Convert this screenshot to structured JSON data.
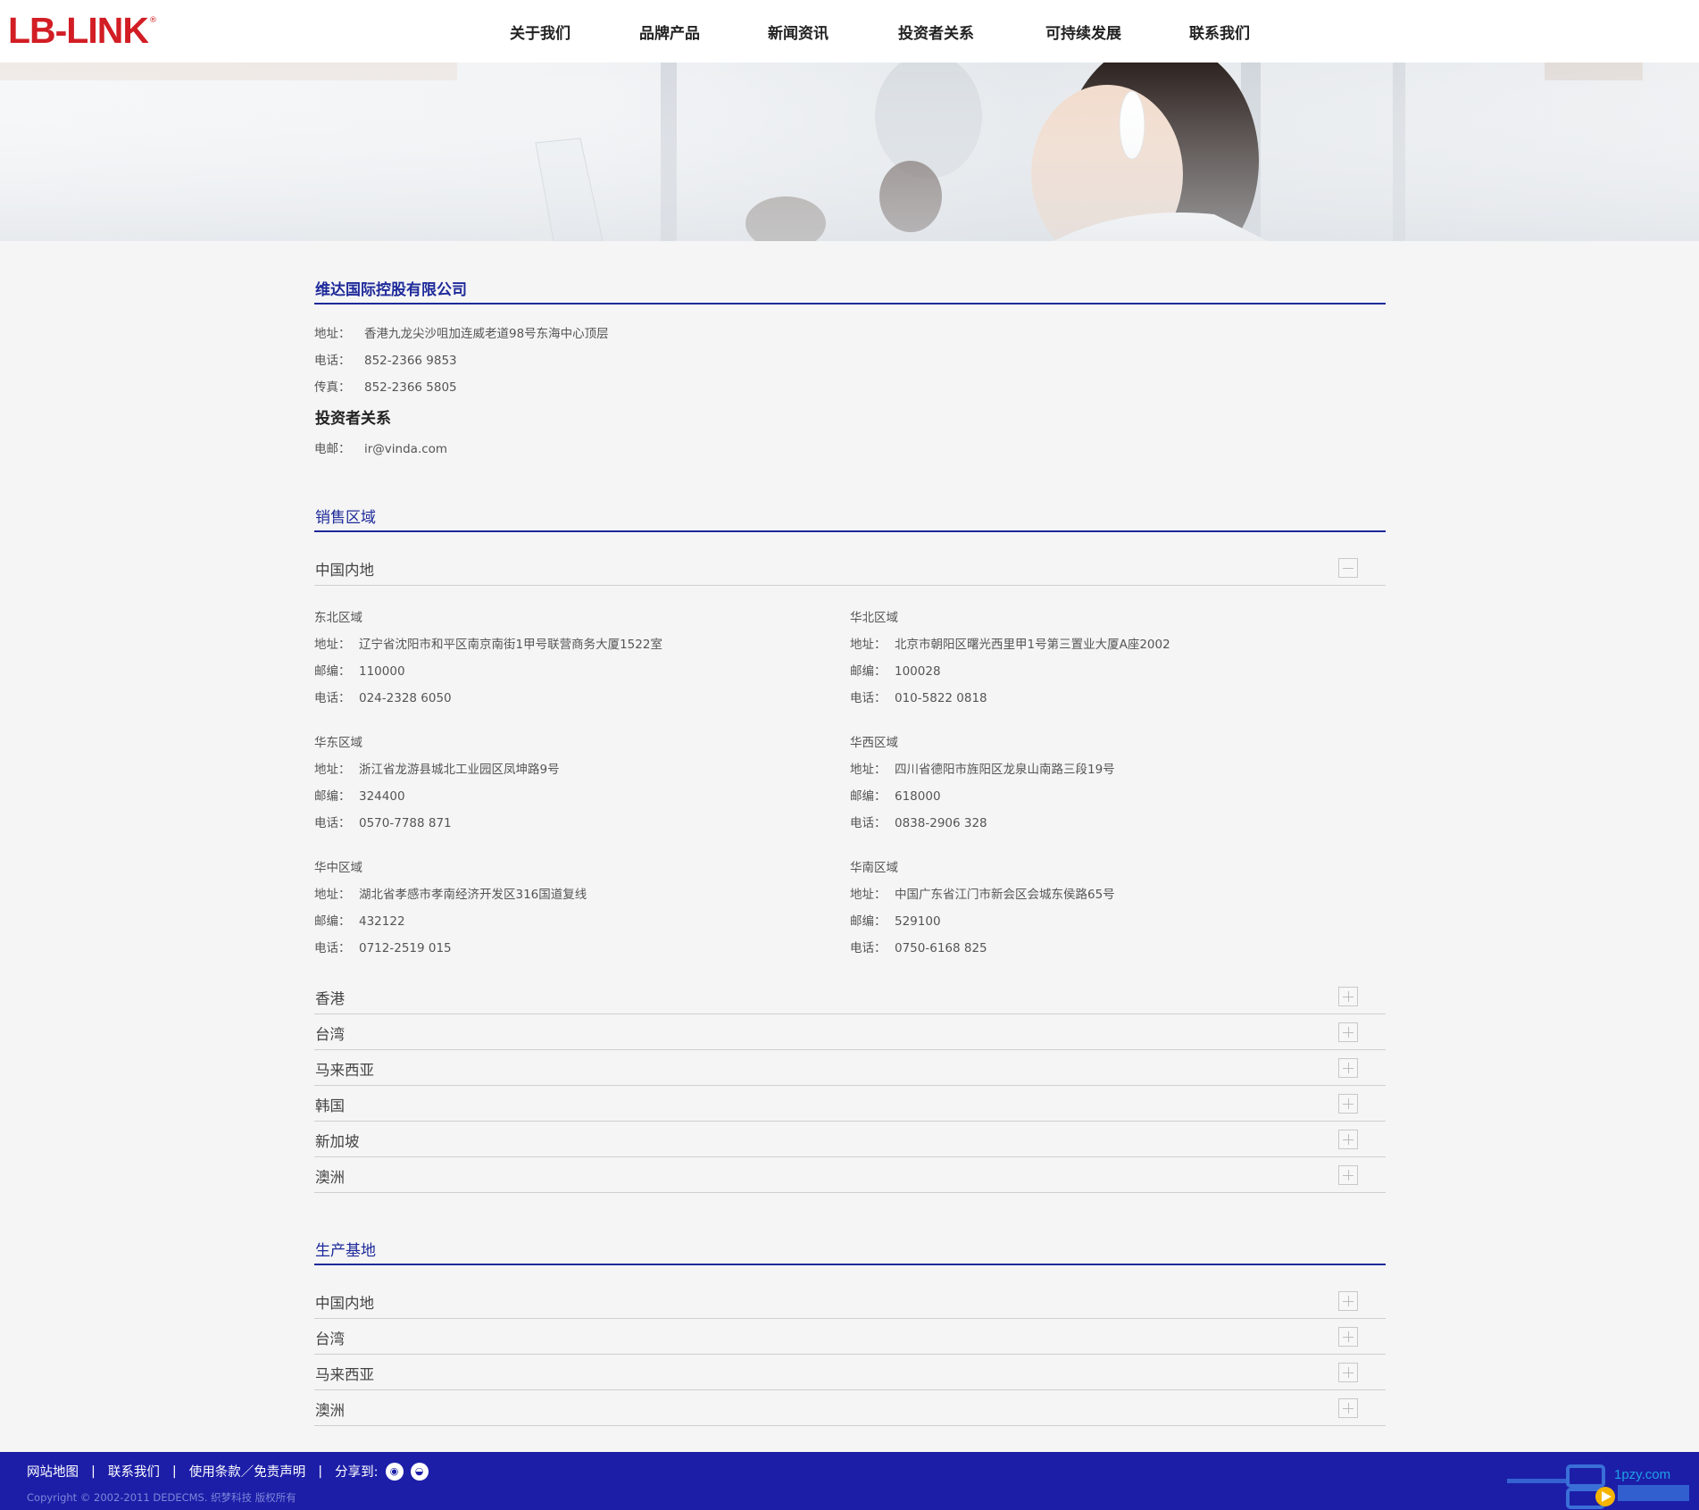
{
  "header": {
    "logo_text": "LB-LINK",
    "logo_mark": "®",
    "nav": [
      "关于我们",
      "品牌产品",
      "新闻资讯",
      "投资者关系",
      "可持续发展",
      "联系我们"
    ]
  },
  "company": {
    "name": "维达国际控股有限公司",
    "rows": [
      {
        "label": "地址：",
        "value": "香港九龙尖沙咀加连威老道98号东海中心顶层"
      },
      {
        "label": "电话：",
        "value": "852-2366 9853"
      },
      {
        "label": "传真：",
        "value": "852-2366 5805"
      }
    ],
    "ir_title": "投资者关系",
    "ir_row": {
      "label": "电邮：",
      "value": "ir@vinda.com"
    }
  },
  "sales": {
    "title": "销售区域",
    "expanded": {
      "label": "中国内地",
      "regions": [
        {
          "name": "东北区域",
          "address_label": "地址：",
          "address": "辽宁省沈阳市和平区南京南街1甲号联营商务大厦1522室",
          "zip_label": "邮编：",
          "zip": "110000",
          "phone_label": "电话：",
          "phone": "024-2328 6050"
        },
        {
          "name": "华北区域",
          "address_label": "地址：",
          "address": "北京市朝阳区曙光西里甲1号第三置业大厦A座2002",
          "zip_label": "邮编：",
          "zip": "100028",
          "phone_label": "电话：",
          "phone": "010-5822 0818"
        },
        {
          "name": "华东区域",
          "address_label": "地址：",
          "address": "浙江省龙游县城北工业园区凤坤路9号",
          "zip_label": "邮编：",
          "zip": "324400",
          "phone_label": "电话：",
          "phone": "0570-7788 871"
        },
        {
          "name": "华西区域",
          "address_label": "地址：",
          "address": "四川省德阳市旌阳区龙泉山南路三段19号",
          "zip_label": "邮编：",
          "zip": "618000",
          "phone_label": "电话：",
          "phone": "0838-2906 328"
        },
        {
          "name": "华中区域",
          "address_label": "地址：",
          "address": "湖北省孝感市孝南经济开发区316国道复线",
          "zip_label": "邮编：",
          "zip": "432122",
          "phone_label": "电话：",
          "phone": "0712-2519 015"
        },
        {
          "name": "华南区域",
          "address_label": "地址：",
          "address": "中国广东省江门市新会区会城东侯路65号",
          "zip_label": "邮编：",
          "zip": "529100",
          "phone_label": "电话：",
          "phone": "0750-6168 825"
        }
      ]
    },
    "collapsed": [
      "香港",
      "台湾",
      "马来西亚",
      "韩国",
      "新加坡",
      "澳洲"
    ]
  },
  "production": {
    "title": "生产基地",
    "collapsed": [
      "中国内地",
      "台湾",
      "马来西亚",
      "澳洲"
    ]
  },
  "footer": {
    "links": [
      "网站地图",
      "联系我们",
      "使用条款／免责声明"
    ],
    "separator": "|",
    "share_label": "分享到:",
    "share_icons": [
      "weibo-icon",
      "wechat-icon"
    ],
    "copyright": "Copyright © 2002-2011 DEDECMS. 织梦科技 版权所有",
    "watermark_text": "1pzy.com"
  },
  "colors": {
    "brand_red": "#d21d24",
    "accent_blue": "#1e2a9a",
    "footer_blue": "#1c1ea8",
    "page_bg": "#f5f5f5"
  }
}
